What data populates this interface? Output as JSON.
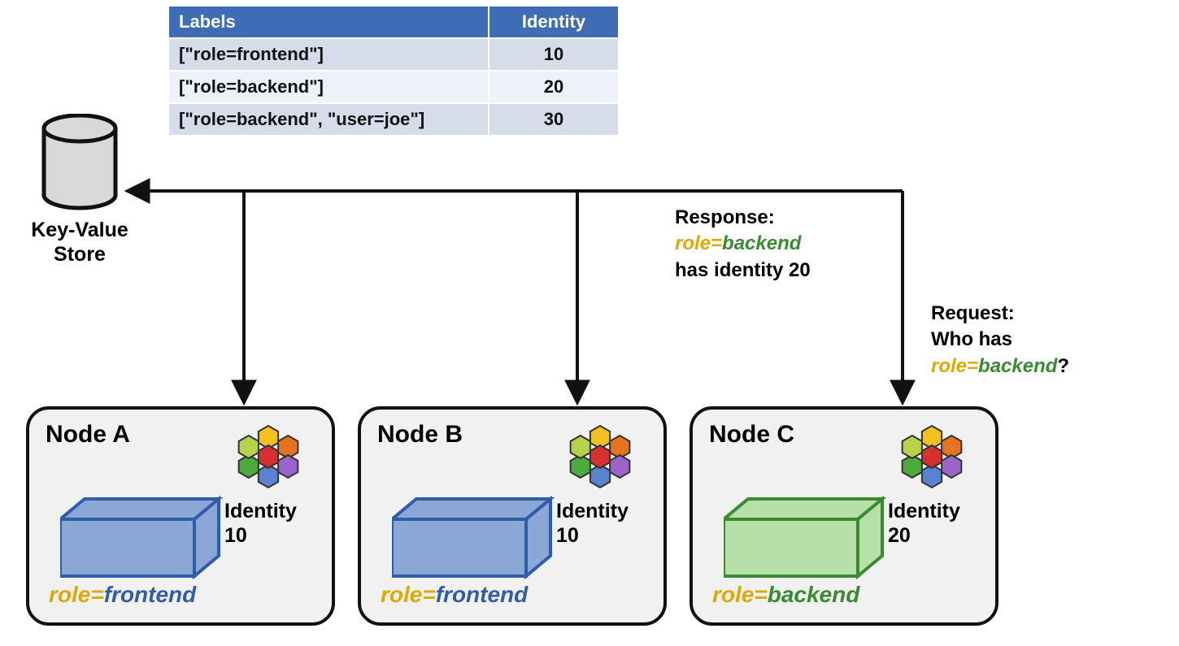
{
  "table": {
    "headers": {
      "labels": "Labels",
      "identity": "Identity"
    },
    "rows": [
      {
        "labels": "[\"role=frontend\"]",
        "identity": "10"
      },
      {
        "labels": "[\"role=backend\"]",
        "identity": "20"
      },
      {
        "labels": "[\"role=backend\", \"user=joe\"]",
        "identity": "30"
      }
    ]
  },
  "kv_store": {
    "label_line1": "Key-Value",
    "label_line2": "Store"
  },
  "response": {
    "line1": "Response:",
    "role": "role",
    "eq": "=",
    "value": "backend",
    "line3": "has identity 20"
  },
  "request": {
    "line1": "Request:",
    "line2": "Who has",
    "role": "role",
    "eq": "=",
    "value": "backend",
    "qmark": "?"
  },
  "nodes": {
    "a": {
      "title": "Node A",
      "identity_word": "Identity",
      "identity_num": "10",
      "role_key": "role",
      "role_eq": "=",
      "role_val": "frontend",
      "color": "blue"
    },
    "b": {
      "title": "Node B",
      "identity_word": "Identity",
      "identity_num": "10",
      "role_key": "role",
      "role_eq": "=",
      "role_val": "frontend",
      "color": "blue"
    },
    "c": {
      "title": "Node C",
      "identity_word": "Identity",
      "identity_num": "20",
      "role_key": "role",
      "role_eq": "=",
      "role_val": "backend",
      "color": "green"
    }
  },
  "colors": {
    "cuboid_blue_fill": "#8aa7d6",
    "cuboid_blue_stroke": "#2f5da8",
    "cuboid_green_fill": "#b7e0a8",
    "cuboid_green_stroke": "#3a8a31"
  }
}
